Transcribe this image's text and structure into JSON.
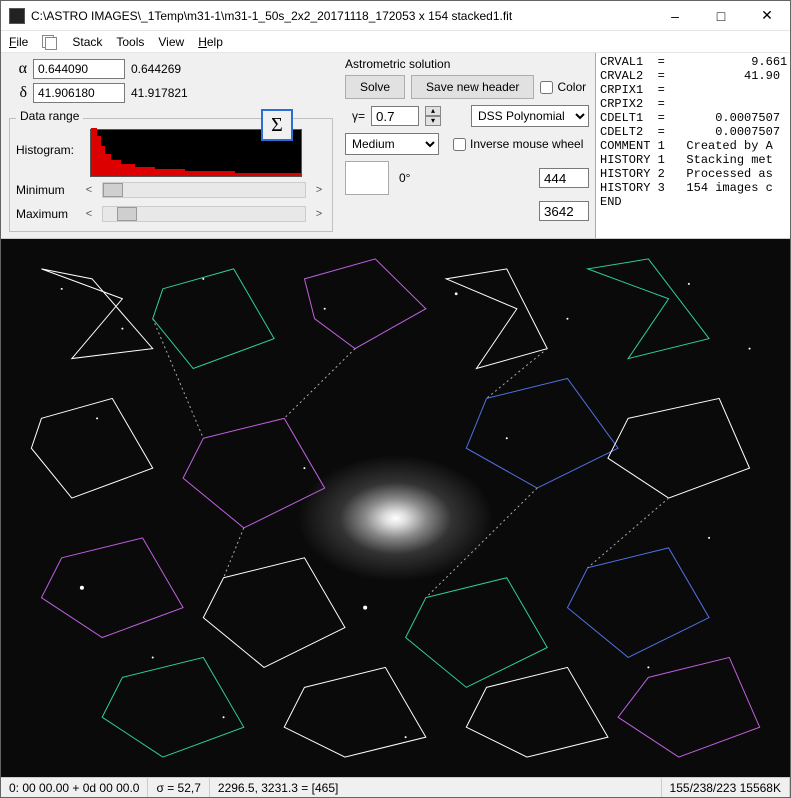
{
  "window": {
    "title": "C:\\ASTRO IMAGES\\_1Temp\\m31-1\\m31-1_50s_2x2_20171118_172053 x 154 stacked1.fit"
  },
  "menu": {
    "file": "File",
    "stack": "Stack",
    "tools": "Tools",
    "view": "View",
    "help": "Help"
  },
  "coords": {
    "alpha_symbol": "α",
    "alpha_value": "0.644090",
    "alpha_display": "0.644269",
    "delta_symbol": "δ",
    "delta_value": "41.906180",
    "delta_display": "41.917821",
    "sigma_symbol": "Σ"
  },
  "data_range": {
    "legend": "Data range",
    "histogram_label": "Histogram:",
    "minimum_label": "Minimum",
    "maximum_label": "Maximum",
    "min_value": "444",
    "max_value": "3642"
  },
  "astrometric": {
    "title": "Astrometric solution",
    "solve_label": "Solve",
    "save_header_label": "Save new header",
    "color_label": "Color",
    "gamma_label": "γ=",
    "gamma_value": "0.7",
    "polynomial_selected": "DSS Polynomial",
    "stretch_selected": "Medium",
    "inverse_wheel_label": "Inverse mouse wheel",
    "rotation_label": "0°"
  },
  "fits_header": "CRVAL1  =            9.661\nCRVAL2  =           41.90\nCRPIX1  =\nCRPIX2  =\nCDELT1  =       0.0007507\nCDELT2  =       0.0007507\nCOMMENT 1   Created by A\nHISTORY 1   Stacking met\nHISTORY 2   Processed as\nHISTORY 3   154 images c\nEND",
  "status": {
    "cell1": "0: 00 00.00  + 0d 00 00.0",
    "cell2": "σ = 52,7",
    "cell3": "2296.5, 3231.3 = [465]",
    "cell4": "155/238/223  15568K"
  }
}
